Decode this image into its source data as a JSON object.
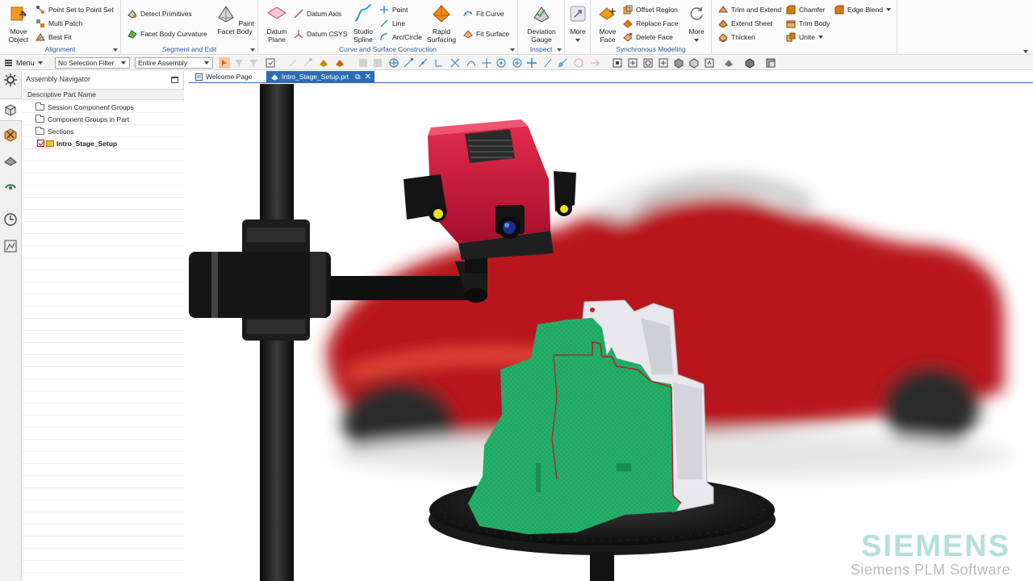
{
  "ribbon": {
    "alignment": {
      "label": "Alignment",
      "move_object": "Move Object",
      "point_set": "Point Set to Point Set",
      "multi_patch": "Multi Patch",
      "best_fit": "Best Fit"
    },
    "segment": {
      "label": "Segment and Edit",
      "detect_primitives": "Detect Primitives",
      "facet_body_curvature": "Facet Body Curvature",
      "paint_facet_body": "Paint Facet Body"
    },
    "curve": {
      "label": "Curve and Surface Construction",
      "datum_plane": "Datum Plane",
      "datum_axis": "Datum Axis",
      "datum_csys": "Datum CSYS",
      "studio_spline": "Studio Spline",
      "point": "Point",
      "line": "Line",
      "arc_circle": "Arc/Circle",
      "rapid_surfacing": "Rapid Surfacing",
      "fit_curve": "Fit Curve",
      "fit_surface": "Fit Surface"
    },
    "inspect": {
      "label": "Inspect",
      "deviation_gauge": "Deviation Gauge",
      "more": "More"
    },
    "synchronous": {
      "label": "Synchronous Modeling",
      "move_face": "Move Face",
      "offset_region": "Offset Region",
      "replace_face": "Replace Face",
      "delete_face": "Delete Face",
      "more": "More"
    },
    "feature": {
      "trim_extend": "Trim and Extend",
      "extend_sheet": "Extend Sheet",
      "thicken": "Thicken",
      "chamfer": "Chamfer",
      "trim_body": "Trim Body",
      "unite": "Unite",
      "edge_blend": "Edge Blend"
    }
  },
  "toolbar": {
    "menu_label": "Menu",
    "selection_filter": "No Selection Filter",
    "scope": "Entire Assembly"
  },
  "navigator": {
    "title": "Assembly Navigator",
    "column_header": "Descriptive Part Name",
    "rows": [
      "Session Component Groups",
      "Component Groups in Part",
      "Sections",
      "Intro_Stage_Setup"
    ]
  },
  "tabs": {
    "welcome": "Welcome Page",
    "part": "Intro_Stage_Setup.prt"
  },
  "watermark": {
    "brand": "SIEMENS",
    "sub": "Siemens PLM Software"
  },
  "colors": {
    "accent": "#2d6db4",
    "group_label": "#2a5d9c",
    "scan_green": "#22b46c",
    "car_red": "#c0161e",
    "scanner_red": "#c8163c"
  }
}
